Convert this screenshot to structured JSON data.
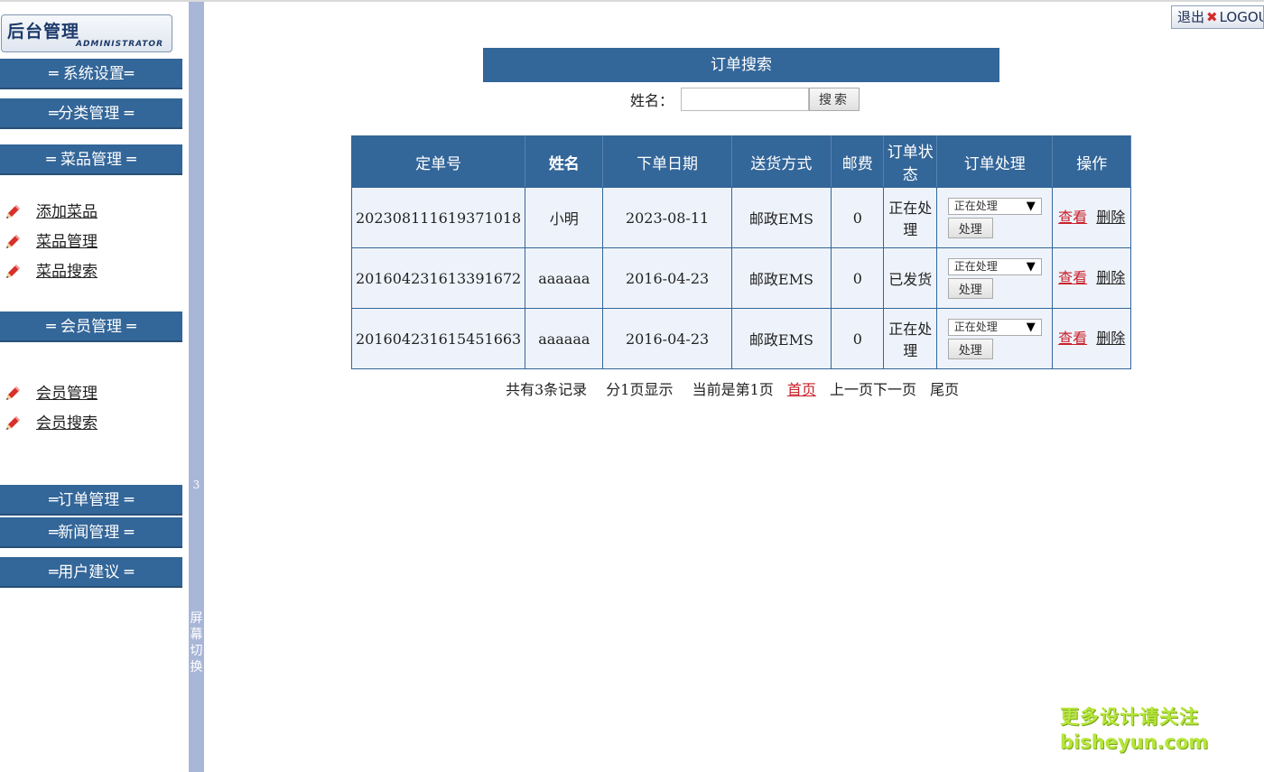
{
  "logo": {
    "main": "后台管理",
    "sub": "ADMINISTRATOR"
  },
  "sidebar": {
    "sections": [
      {
        "label": "═ 系统设置═"
      },
      {
        "label": "═分类管理 ═"
      },
      {
        "label": "═ 菜品管理 ═"
      },
      {
        "label": "═ 会员管理 ═"
      },
      {
        "label": "═订单管理 ═"
      },
      {
        "label": "═新闻管理 ═"
      },
      {
        "label": "═用户建议 ═"
      }
    ],
    "dish_links": [
      "添加菜品",
      "菜品管理",
      "菜品搜索"
    ],
    "member_links": [
      "会员管理",
      "会员搜索"
    ]
  },
  "splitter": {
    "number": "3",
    "label": "屏幕切换"
  },
  "logout": {
    "label": "退出",
    "label_en": "LOGOUT"
  },
  "search": {
    "title": "订单搜索",
    "name_label": "姓名：",
    "name_value": "",
    "button": "搜索"
  },
  "table": {
    "headers": [
      "定单号",
      "姓名",
      "下单日期",
      "送货方式",
      "邮费",
      "订单状态",
      "订单处理",
      "操作"
    ],
    "rows": [
      {
        "order_no": "202308111619371018",
        "name": "小明",
        "date": "2023-08-11",
        "shipping": "邮政EMS",
        "postage": "0",
        "status": "正在处理",
        "process_value": "正在处理",
        "process_button": "处理",
        "view": "查看",
        "delete": "删除"
      },
      {
        "order_no": "201604231613391672",
        "name": "aaaaaa",
        "date": "2016-04-23",
        "shipping": "邮政EMS",
        "postage": "0",
        "status": "已发货",
        "process_value": "正在处理",
        "process_button": "处理",
        "view": "查看",
        "delete": "删除"
      },
      {
        "order_no": "201604231615451663",
        "name": "aaaaaa",
        "date": "2016-04-23",
        "shipping": "邮政EMS",
        "postage": "0",
        "status": "正在处理",
        "process_value": "正在处理",
        "process_button": "处理",
        "view": "查看",
        "delete": "删除"
      }
    ]
  },
  "pager": {
    "total": "共有3条记录",
    "pages": "分1页显示",
    "current": "当前是第1页",
    "first": "首页",
    "prev": "上一页",
    "next": "下一页",
    "last": "尾页"
  },
  "watermark": {
    "line1": "更多设计请关注",
    "line2": "bisheyun.com"
  },
  "colors": {
    "header_blue": "#336699",
    "splitter": "#a8b6d8",
    "link_red": "#c8202a",
    "row_bg": "#eef3fb"
  }
}
